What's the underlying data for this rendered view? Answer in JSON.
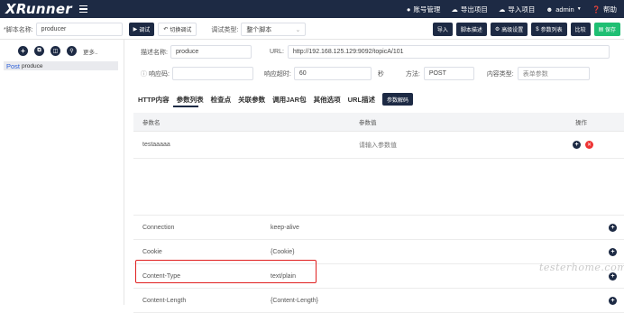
{
  "app": {
    "logo": "XRunner"
  },
  "topbar": {
    "account": "账号管理",
    "export": "导出项目",
    "import": "导入项目",
    "user": "admin",
    "help": "帮助"
  },
  "toolbar": {
    "script_name_label": "*脚本名称:",
    "script_name_value": "producer",
    "debug": "调试",
    "switch_debug": "切换调试",
    "debug_type_label": "调试类型:",
    "debug_type_value": "整个脚本",
    "import": "导入",
    "script_desc": "脚本描述",
    "advanced": "高级设置",
    "param_list": "参数列表",
    "compare": "比较",
    "save": "保存"
  },
  "sidebar": {
    "more": "更多..",
    "item_method": "Post",
    "item_name": "produce"
  },
  "form": {
    "desc_label": "描述名称:",
    "desc_value": "produce",
    "url_label": "URL:",
    "url_value": "http://192.168.125.129:9092/topicA/101",
    "response_label": "响应码:",
    "timeout_label": "响应超时:",
    "timeout_value": "60",
    "timeout_unit": "秒",
    "method_label": "方法:",
    "method_value": "POST",
    "content_type_label": "内容类型:",
    "content_type_placeholder": "表单参数"
  },
  "tabs": [
    "HTTP内容",
    "参数列表",
    "检查点",
    "关联参数",
    "调用JAR包",
    "其他选项",
    "URL描述"
  ],
  "decode_button": "参数解码",
  "param_table": {
    "headers": [
      "参数名",
      "参数值",
      "操作"
    ],
    "rows": [
      {
        "name": "testaaaaa",
        "value": "请输入参数值"
      }
    ]
  },
  "header_rows": [
    {
      "name": "Connection",
      "value": "keep-alive"
    },
    {
      "name": "Cookie",
      "value": "{Cookie}"
    },
    {
      "name": "Content-Type",
      "value": "text/plain"
    },
    {
      "name": "Content-Length",
      "value": "{Content-Length}"
    }
  ],
  "watermark": "testerhome.com",
  "colors": {
    "brand": "#1d2a44",
    "save": "#1fbf73",
    "delete": "#e33333",
    "highlight": "#e02020"
  }
}
